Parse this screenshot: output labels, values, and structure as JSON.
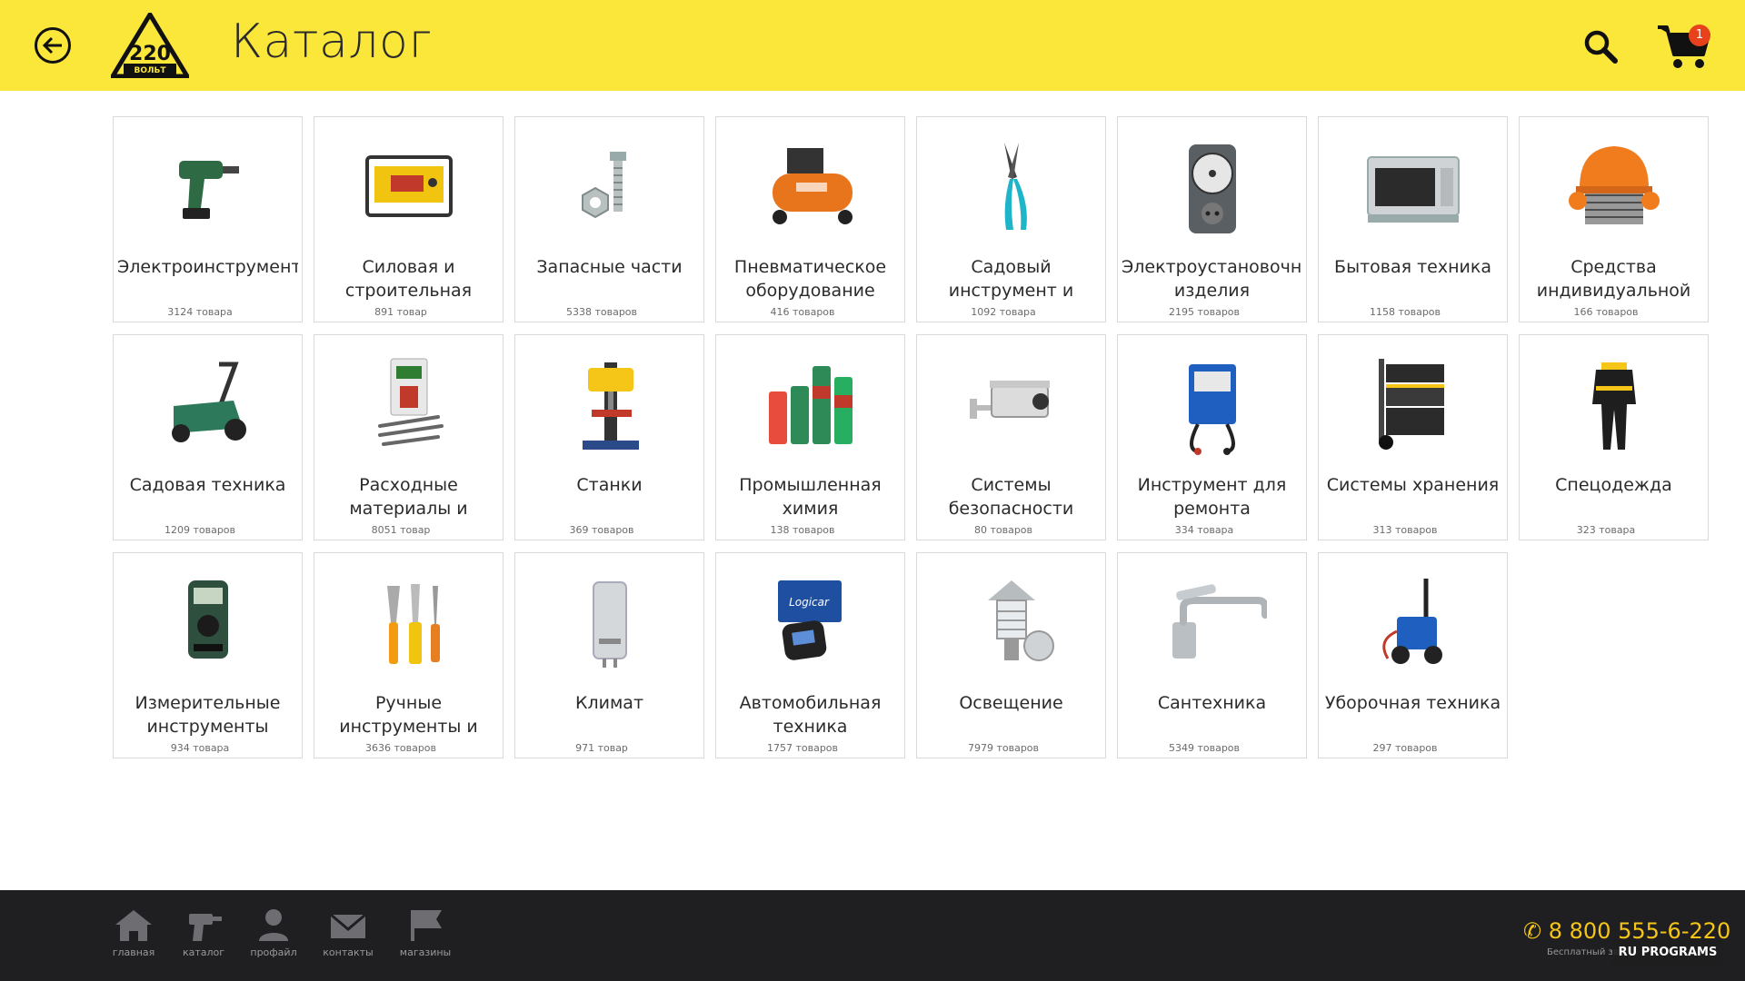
{
  "header": {
    "title": "Каталог",
    "logo_text": "220",
    "logo_subtext": "ВОЛЬТ",
    "cart_count": "1"
  },
  "colors": {
    "header_bg": "#fbe63a",
    "footer_bg": "#1f1f21",
    "accent": "#f5c518",
    "badge": "#e8421c"
  },
  "categories": [
    {
      "name": "Электроинструменты",
      "count": "3124 товара",
      "icon": "drill-icon"
    },
    {
      "name": "Силовая и строительная",
      "count": "891 товар",
      "icon": "generator-icon"
    },
    {
      "name": "Запасные части",
      "count": "5338 товаров",
      "icon": "bolt-nut-icon"
    },
    {
      "name": "Пневматическое оборудование",
      "count": "416 товаров",
      "icon": "compressor-icon"
    },
    {
      "name": "Садовый инструмент и инвентарь",
      "count": "1092 товара",
      "icon": "pruner-icon"
    },
    {
      "name": "Электроустановочные изделия",
      "count": "2195 товаров",
      "icon": "socket-timer-icon"
    },
    {
      "name": "Бытовая техника",
      "count": "1158 товаров",
      "icon": "microwave-icon"
    },
    {
      "name": "Средства индивидуальной",
      "count": "166 товаров",
      "icon": "helmet-icon"
    },
    {
      "name": "Садовая техника",
      "count": "1209 товаров",
      "icon": "lawnmower-icon"
    },
    {
      "name": "Расходные материалы и",
      "count": "8051 товар",
      "icon": "drill-bits-icon"
    },
    {
      "name": "Станки",
      "count": "369 товаров",
      "icon": "drill-press-icon"
    },
    {
      "name": "Промышленная химия",
      "count": "138 товаров",
      "icon": "spray-cans-icon"
    },
    {
      "name": "Системы безопасности",
      "count": "80 товаров",
      "icon": "security-camera-icon"
    },
    {
      "name": "Инструмент для ремонта автомобиля",
      "count": "334 товара",
      "icon": "battery-tester-icon"
    },
    {
      "name": "Системы хранения",
      "count": "313 товаров",
      "icon": "tool-trolley-icon"
    },
    {
      "name": "Спецодежда",
      "count": "323 товара",
      "icon": "workwear-icon"
    },
    {
      "name": "Измерительные инструменты",
      "count": "934 товара",
      "icon": "multimeter-icon"
    },
    {
      "name": "Ручные инструменты и приспособления",
      "count": "3636 товаров",
      "icon": "hand-tools-icon"
    },
    {
      "name": "Климат",
      "count": "971 товар",
      "icon": "water-heater-icon"
    },
    {
      "name": "Автомобильная техника",
      "count": "1757 товаров",
      "icon": "car-alarm-icon"
    },
    {
      "name": "Освещение",
      "count": "7979 товаров",
      "icon": "wall-lamp-icon"
    },
    {
      "name": "Сантехника",
      "count": "5349 товаров",
      "icon": "faucet-icon"
    },
    {
      "name": "Уборочная техника",
      "count": "297 товаров",
      "icon": "pressure-washer-icon"
    }
  ],
  "footer": {
    "nav": [
      {
        "label": "главная",
        "icon": "home-icon"
      },
      {
        "label": "каталог",
        "icon": "drill-nav-icon"
      },
      {
        "label": "профайл",
        "icon": "user-icon"
      },
      {
        "label": "контакты",
        "icon": "mail-icon"
      },
      {
        "label": "магазины",
        "icon": "flag-icon"
      }
    ],
    "phone": "8 800 555-6-220",
    "phone_note": "Бесплатный зв",
    "watermark": "RU PROGRAMS"
  }
}
